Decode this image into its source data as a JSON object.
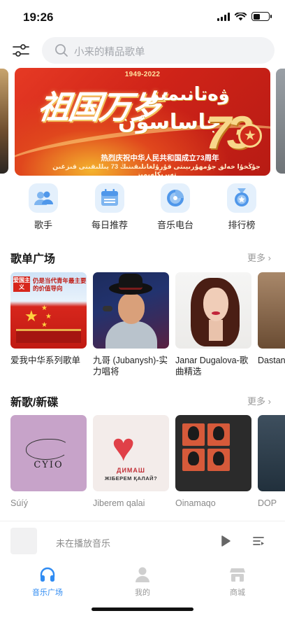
{
  "status_bar": {
    "time": "19:26",
    "battery_level": 0.45
  },
  "search": {
    "placeholder": "小来的精品歌单"
  },
  "banner": {
    "years": "1949-2022",
    "title_cn": "祖国万岁",
    "title_ug_line1": "ۋەتانىمىز",
    "title_ug_line2": "جاساسۇن",
    "number": "73",
    "subtitle_cn": "热烈庆祝中华人民共和国成立73周年",
    "subtitle_ug": "جۇڭخۇا خەلق جۇمھۇرىيىتى قۇرۇلغانلىقىنىڭ 73 يىللىقىنى قىزغىن تەبرىكلەيمىز"
  },
  "quick_links": [
    {
      "label": "歌手",
      "icon": "singer-icon"
    },
    {
      "label": "每日推荐",
      "icon": "calendar-icon"
    },
    {
      "label": "音乐电台",
      "icon": "radio-icon"
    },
    {
      "label": "排行榜",
      "icon": "medal-icon"
    }
  ],
  "playlist_section": {
    "title": "歌单广场",
    "more": "更多",
    "items": [
      {
        "title": "爱我中华系列歌单",
        "cover_text": "爱国主义",
        "cover_caption": "仍是当代青年最主要的价值导向"
      },
      {
        "title": "九哥 (Jubanysh)-实力唱将"
      },
      {
        "title": "Janar Dugalova-歌曲精选"
      },
      {
        "title": "Dastan (精选"
      }
    ]
  },
  "album_section": {
    "title": "新歌/新碟",
    "more": "更多",
    "items": [
      {
        "title": "Súíý",
        "cover_text": "CYIO"
      },
      {
        "title": "Jiberem qalai",
        "cover_text": "ДИМАШ",
        "cover_subtext": "ЖІБЕРЕМ ҚАЛАЙ?"
      },
      {
        "title": "Oinamaqo"
      },
      {
        "title": "DOP"
      }
    ]
  },
  "player": {
    "status": "未在播放音乐"
  },
  "tabs": [
    {
      "label": "音乐广场",
      "icon": "headphones-icon",
      "active": true
    },
    {
      "label": "我的",
      "icon": "profile-icon",
      "active": false
    },
    {
      "label": "商城",
      "icon": "store-icon",
      "active": false
    }
  ],
  "colors": {
    "accent": "#2f8bf2",
    "quick_tile_bg": "#e4f0fc",
    "banner_red": "#cf2318"
  }
}
